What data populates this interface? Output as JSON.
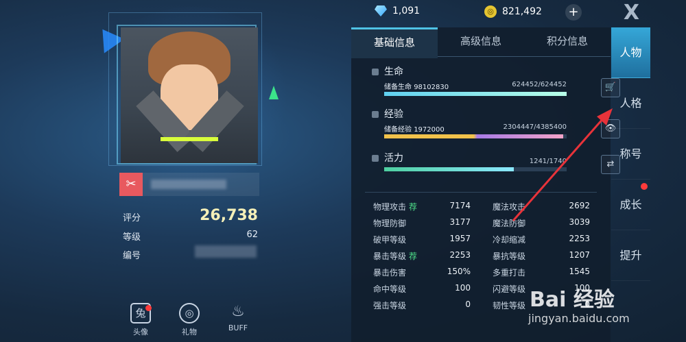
{
  "currency": {
    "diamonds": "1,091",
    "coins": "821,492",
    "coin_icon_glyph": "◎",
    "plus_glyph": "+"
  },
  "character": {
    "name_icon_glyph": "✂",
    "score_label": "评分",
    "score_value": "26,738",
    "level_label": "等级",
    "level_value": "62",
    "id_label": "编号"
  },
  "bottom_buttons": [
    {
      "label": "头像",
      "icon": "rabbit-avatar-icon",
      "glyph": "兔",
      "badge": true
    },
    {
      "label": "礼物",
      "icon": "gift-swirl-icon",
      "glyph": "◎",
      "badge": false
    },
    {
      "label": "BUFF",
      "icon": "flame-buff-icon",
      "glyph": "♨",
      "badge": false
    }
  ],
  "tabs": [
    {
      "label": "基础信息",
      "active": true
    },
    {
      "label": "高级信息",
      "active": false
    },
    {
      "label": "积分信息",
      "active": false
    }
  ],
  "bars": {
    "life": {
      "title": "生命",
      "sub_label": "储备生命",
      "sub_value": "98102830",
      "numbers": "624452/624452",
      "fraction": 1.0
    },
    "exp": {
      "title": "经验",
      "sub_label": "储备经验",
      "sub_value": "1972000",
      "numbers": "2304447/4385400",
      "fraction": 0.98
    },
    "vitality": {
      "title": "活力",
      "numbers": "1241/1740",
      "fraction": 0.71
    }
  },
  "side_buttons": {
    "cart": "🛒",
    "eye": "👁",
    "swap": "⇄"
  },
  "attributes": [
    {
      "name": "物理攻击",
      "tag": "荐",
      "value": "7174"
    },
    {
      "name": "魔法攻击",
      "tag": "",
      "value": "2692"
    },
    {
      "name": "物理防御",
      "tag": "",
      "value": "3177"
    },
    {
      "name": "魔法防御",
      "tag": "",
      "value": "3039"
    },
    {
      "name": "破甲等级",
      "tag": "",
      "value": "1957"
    },
    {
      "name": "冷却缩减",
      "tag": "",
      "value": "2253"
    },
    {
      "name": "暴击等级",
      "tag": "荐",
      "value": "2253"
    },
    {
      "name": "暴抗等级",
      "tag": "",
      "value": "1207"
    },
    {
      "name": "暴击伤害",
      "tag": "",
      "value": "150%"
    },
    {
      "name": "多重打击",
      "tag": "",
      "value": "1545"
    },
    {
      "name": "命中等级",
      "tag": "",
      "value": "100"
    },
    {
      "name": "闪避等级",
      "tag": "",
      "value": "100"
    },
    {
      "name": "强击等级",
      "tag": "",
      "value": "0"
    },
    {
      "name": "韧性等级",
      "tag": "",
      "value": "0"
    }
  ],
  "nav": {
    "close_glyph": "X",
    "items": [
      "人物",
      "人格",
      "称号",
      "成长",
      "提升"
    ],
    "active": "人物"
  },
  "watermark": {
    "logo": "Bai 经验",
    "url": "jingyan.baidu.com"
  },
  "colors": {
    "accent": "#4fc3e6",
    "life_bar": "#5fd0f0",
    "exp_bar_gold": "#f1c24b",
    "exp_bar_purple": "#a77be6",
    "vitality_bar": "#4ecfa0",
    "arrow": "#e8333a",
    "score": "#f5f0b8"
  }
}
